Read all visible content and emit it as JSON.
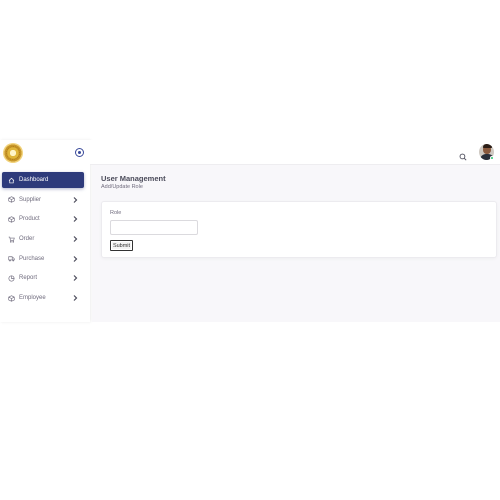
{
  "sidebar": {
    "logo": "gold-emblem-logo",
    "toggle_icon": "circle-dot-icon",
    "items": [
      {
        "label": "Dashboard",
        "icon": "smart-home-icon",
        "active": true,
        "has_submenu": false
      },
      {
        "label": "Supplier",
        "icon": "box-icon",
        "active": false,
        "has_submenu": true
      },
      {
        "label": "Product",
        "icon": "box-icon",
        "active": false,
        "has_submenu": true
      },
      {
        "label": "Order",
        "icon": "shopping-cart-icon",
        "active": false,
        "has_submenu": true
      },
      {
        "label": "Purchase",
        "icon": "truck-icon",
        "active": false,
        "has_submenu": true
      },
      {
        "label": "Report",
        "icon": "chart-pie-icon",
        "active": false,
        "has_submenu": true
      },
      {
        "label": "Employee",
        "icon": "box-icon",
        "active": false,
        "has_submenu": true
      }
    ]
  },
  "topbar": {
    "search_icon": "search-icon",
    "avatar": "user-avatar",
    "status_color": "#28c76f"
  },
  "page": {
    "title": "User Management",
    "subtitle": "Add/Update Role"
  },
  "form": {
    "role_label": "Role",
    "role_value": "",
    "role_placeholder": "",
    "submit_label": "Submit"
  },
  "colors": {
    "accent": "#2d3a7b",
    "background": "#f8f7fa"
  }
}
